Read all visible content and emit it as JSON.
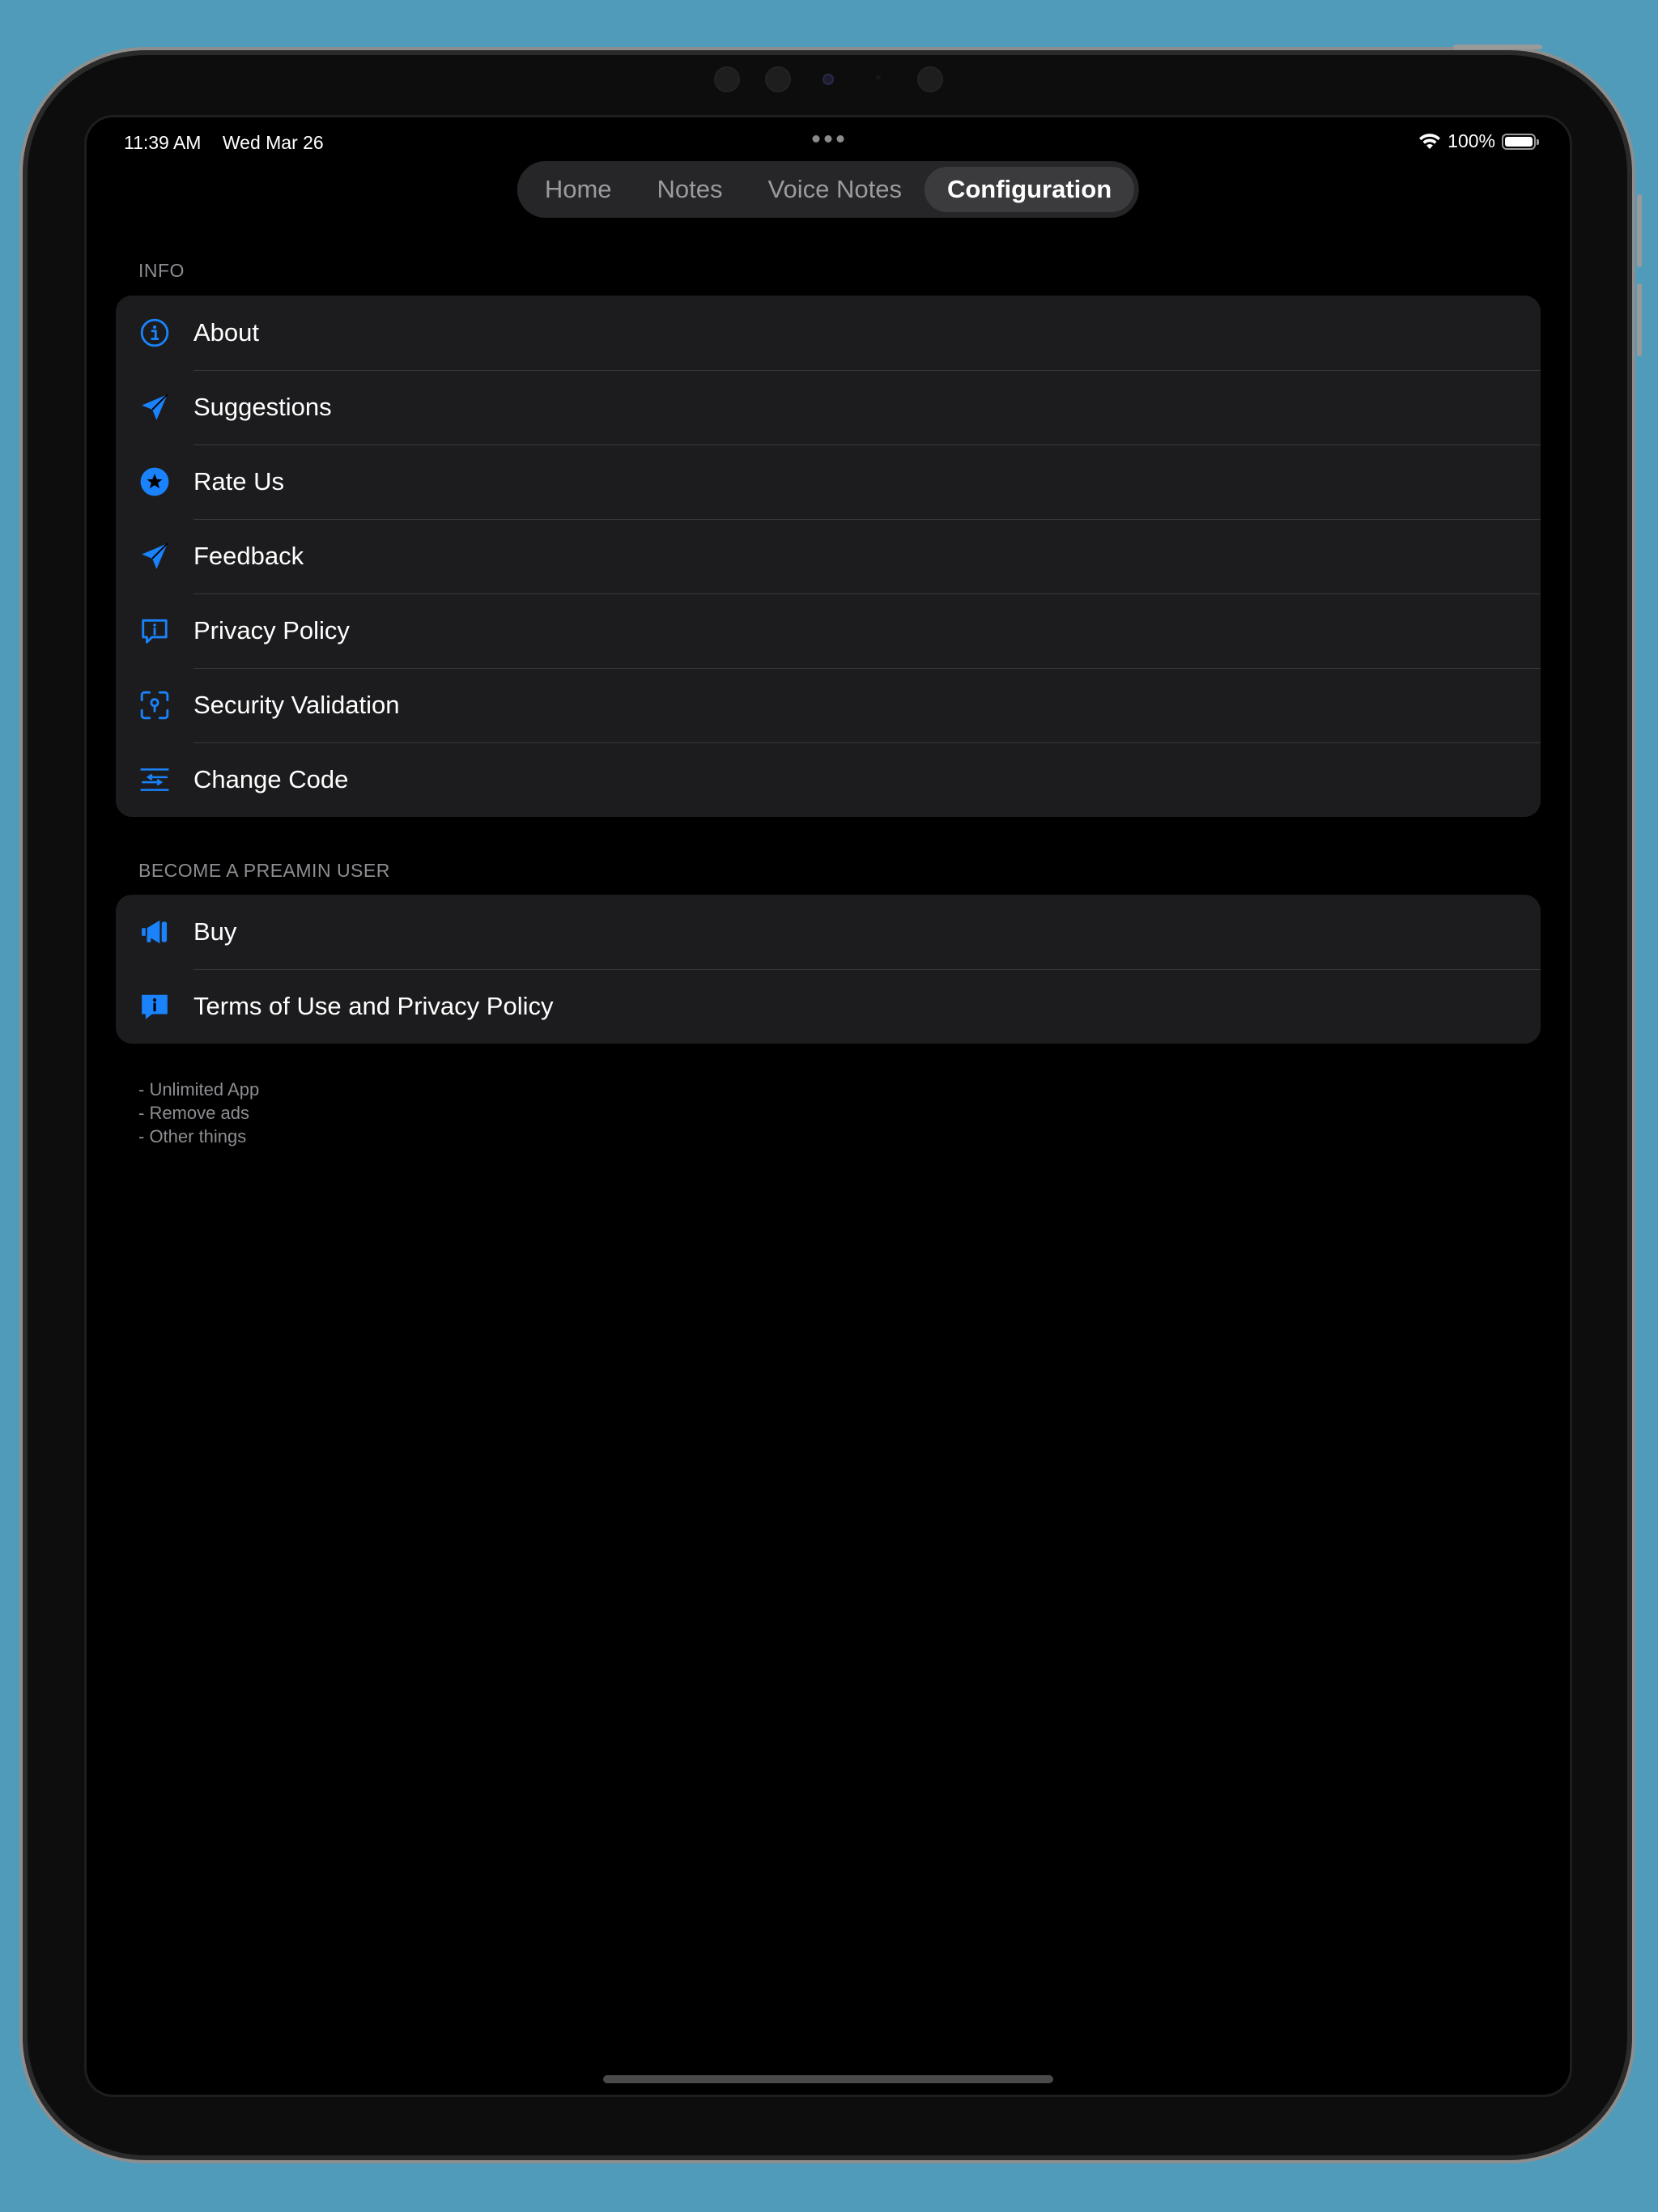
{
  "status_bar": {
    "time": "11:39 AM",
    "date": "Wed Mar 26",
    "battery_percent": "100%",
    "battery_level": 1.0
  },
  "tabs": [
    {
      "label": "Home",
      "active": false
    },
    {
      "label": "Notes",
      "active": false
    },
    {
      "label": "Voice Notes",
      "active": false
    },
    {
      "label": "Configuration",
      "active": true
    }
  ],
  "info_section": {
    "header": "INFO",
    "items": [
      {
        "label": "About",
        "icon": "info-circle-icon"
      },
      {
        "label": "Suggestions",
        "icon": "paper-plane-icon"
      },
      {
        "label": "Rate Us",
        "icon": "star-circle-icon"
      },
      {
        "label": "Feedback",
        "icon": "paper-plane-icon"
      },
      {
        "label": "Privacy Policy",
        "icon": "info-bubble-icon"
      },
      {
        "label": "Security Validation",
        "icon": "faceid-icon"
      },
      {
        "label": "Change Code",
        "icon": "arrows-switch-icon"
      }
    ]
  },
  "premium_section": {
    "header": "BECOME A PREAMIN USER",
    "items": [
      {
        "label": "Buy",
        "icon": "megaphone-icon"
      },
      {
        "label": "Terms of Use and Privacy Policy",
        "icon": "info-bubble-filled-icon"
      }
    ],
    "footer_lines": [
      "- Unlimited App",
      "- Remove ads",
      "- Other things"
    ]
  },
  "colors": {
    "accent": "#1a82fb",
    "background": "#000000",
    "cell": "#1c1c1e",
    "secondary_text": "#8d8d92"
  }
}
